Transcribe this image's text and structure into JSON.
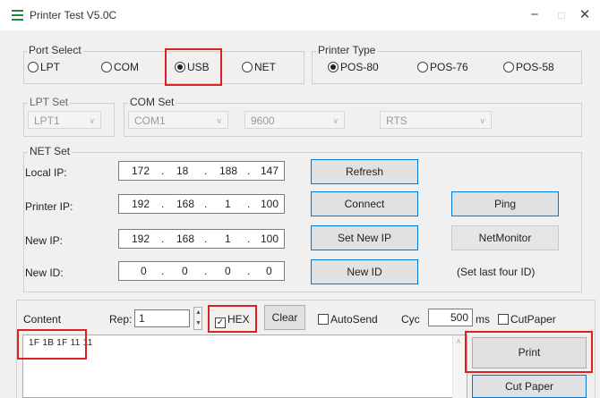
{
  "window": {
    "title": "Printer Test V5.0C",
    "controls": [
      "−",
      "□",
      "✕"
    ]
  },
  "port_select": {
    "label": "Port Select",
    "options": [
      {
        "label": "LPT",
        "selected": false
      },
      {
        "label": "COM",
        "selected": false
      },
      {
        "label": "USB",
        "selected": true
      },
      {
        "label": "NET",
        "selected": false
      }
    ]
  },
  "printer_type": {
    "label": "Printer Type",
    "options": [
      {
        "label": "POS-80",
        "selected": true
      },
      {
        "label": "POS-76",
        "selected": false
      },
      {
        "label": "POS-58",
        "selected": false
      }
    ]
  },
  "lpt_set": {
    "label": "LPT Set",
    "value": "LPT1"
  },
  "com_set": {
    "label": "COM Set",
    "port": "COM1",
    "baud": "9600",
    "flow": "RTS"
  },
  "net_set": {
    "label": "NET Set",
    "local_ip": {
      "label": "Local IP:",
      "octets": [
        "172",
        "18",
        "188",
        "147"
      ]
    },
    "printer_ip": {
      "label": "Printer IP:",
      "octets": [
        "192",
        "168",
        "1",
        "100"
      ]
    },
    "new_ip": {
      "label": "New IP:",
      "octets": [
        "192",
        "168",
        "1",
        "100"
      ]
    },
    "new_id": {
      "label": "New ID:",
      "octets": [
        "0",
        "0",
        "0",
        "0"
      ]
    },
    "buttons": {
      "refresh": "Refresh",
      "connect": "Connect",
      "set_new_ip": "Set New IP",
      "new_id": "New ID",
      "ping": "Ping",
      "net_monitor": "NetMonitor"
    },
    "new_id_note": "(Set last four ID)"
  },
  "content": {
    "label": "Content",
    "rep_label": "Rep:",
    "rep_value": "1",
    "hex_label": "HEX",
    "hex_checked": true,
    "clear_label": "Clear",
    "autosend_label": "AutoSend",
    "autosend_checked": false,
    "cyc_label": "Cyc",
    "cyc_value": "500",
    "cyc_unit": "ms",
    "cutpaper_check_label": "CutPaper",
    "cutpaper_checked": false,
    "text": "1F 1B 1F 11 11",
    "print_label": "Print",
    "cut_paper_label": "Cut Paper"
  },
  "colors": {
    "highlight": "#e02020",
    "focus_border": "#0078d7",
    "window_bg": "#f0f0f0"
  }
}
